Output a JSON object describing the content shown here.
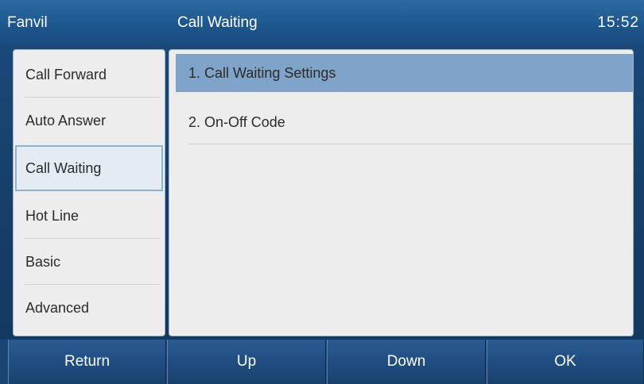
{
  "header": {
    "brand": "Fanvil",
    "title": "Call Waiting",
    "clock": "15:52"
  },
  "sidebar": {
    "items": [
      {
        "label": "Call Forward"
      },
      {
        "label": "Auto Answer"
      },
      {
        "label": "Call Waiting",
        "active": true
      },
      {
        "label": "Hot Line"
      },
      {
        "label": "Basic"
      },
      {
        "label": "Advanced"
      }
    ]
  },
  "options": {
    "items": [
      {
        "label": "1. Call Waiting Settings",
        "selected": true
      },
      {
        "label": "2. On-Off Code"
      }
    ]
  },
  "softkeys": {
    "return": "Return",
    "up": "Up",
    "down": "Down",
    "ok": "OK"
  },
  "colors": {
    "header": "#1d578d",
    "selection": "#7fa3c9",
    "panel": "#ededed",
    "softkey": "#214f82"
  }
}
